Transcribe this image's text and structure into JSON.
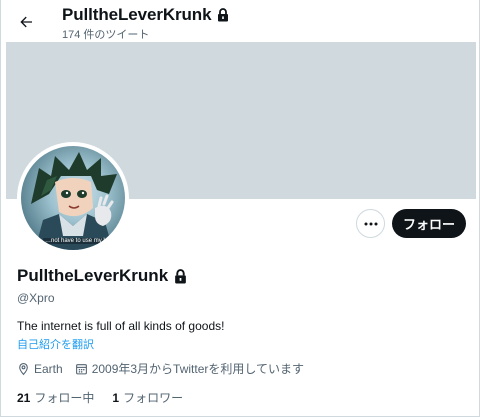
{
  "header": {
    "title": "PulltheLeverKrunk",
    "tweet_count": "174 件のツイート"
  },
  "profile": {
    "display_name": "PulltheLeverKrunk",
    "handle": "@Xpro",
    "bio": "The internet is full of all kinds of goods!",
    "translate_label": "自己紹介を翻訳",
    "location": "Earth",
    "joined": "2009年3月からTwitterを利用しています",
    "avatar_caption": "…not have to use my b…"
  },
  "actions": {
    "follow_label": "フォロー"
  },
  "stats": {
    "following_count": "21",
    "following_label": "フォロー中",
    "followers_count": "1",
    "followers_label": "フォロワー"
  },
  "colors": {
    "banner": "#cfd9de",
    "accent": "#1d9bf0",
    "button_dark": "#0f1419",
    "secondary_text": "#536471"
  }
}
